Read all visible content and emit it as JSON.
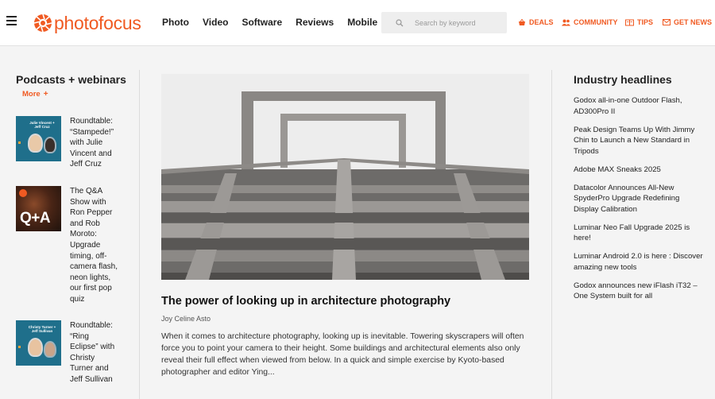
{
  "header": {
    "logo_text": "photofocus",
    "nav": [
      "Photo",
      "Video",
      "Software",
      "Reviews",
      "Mobile"
    ],
    "search_placeholder": "Search by keyword",
    "util": {
      "deals": "DEALS",
      "community": "COMMUNITY",
      "tips": "TIPS",
      "news": "GET NEWS"
    },
    "accent_color": "#f05a22"
  },
  "left": {
    "title": "Podcasts + webinars",
    "more_label": "More",
    "more_icon": "+",
    "items": [
      {
        "text": "Roundtable: “Stampede!” with Julie Vincent and Jeff Cruz",
        "thumb_text": "Julie Vincent + Jeff Cruz"
      },
      {
        "text": "The Q&A Show with Ron Pepper and Rob Moroto: Upgrade timing, off-camera flash, neon lights, our first pop quiz",
        "thumb_text": "Q+A"
      },
      {
        "text": "Roundtable: “Ring Eclipse” with Christy Turner and Jeff Sullivan",
        "thumb_text": "Christy Turner + Jeff Sullivan"
      }
    ]
  },
  "article": {
    "headline": "The power of looking up in architecture photography",
    "author": "Joy Celine Asto",
    "excerpt": "When it comes to architecture photography, looking up is inevitable. Towering skyscrapers will often force you to point your camera to their height. Some buildings and architectural elements also only reveal their full effect when viewed from below. In a quick and simple exercise by Kyoto-based photographer and editor Ying..."
  },
  "right": {
    "title": "Industry headlines",
    "items": [
      "Godox all-in-one Outdoor Flash, AD300Pro II",
      "Peak Design Teams Up With Jimmy Chin to Launch a New Standard in Tripods",
      "Adobe MAX Sneaks 2025",
      "Datacolor Announces All-New SpyderPro Upgrade Redefining Display Calibration",
      "Luminar Neo Fall Upgrade 2025 is here!",
      "Luminar Android 2.0 is here : Discover amazing new tools",
      "Godox announces new iFlash iT32 – One System built for all"
    ]
  }
}
